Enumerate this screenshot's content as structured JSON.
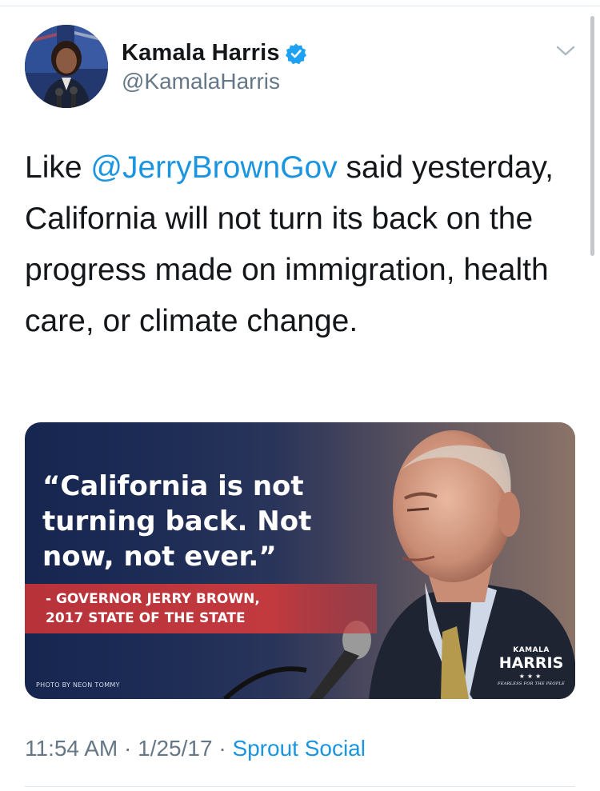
{
  "author": {
    "name": "Kamala Harris",
    "handle": "@KamalaHarris",
    "verified": true,
    "avatar_icon": "profile-photo"
  },
  "tweet": {
    "text_before_mention": "Like ",
    "mention": "@JerryBrownGov",
    "text_after_mention": " said yesterday, California will not turn its back on the progress made on immigration, health care, or climate change."
  },
  "media": {
    "quote": "“California is not turning back. Not now, not ever.”",
    "attribution_line1": "- GOVERNOR JERRY BROWN,",
    "attribution_line2": "2017 STATE OF THE STATE",
    "photo_credit": "PHOTO BY NEON TOMMY",
    "logo_top": "KAMALA",
    "logo_name": "HARRIS",
    "logo_stars": "★★★",
    "logo_tagline": "FEARLESS FOR THE PEOPLE"
  },
  "meta": {
    "time": "11:54 AM",
    "separator": " · ",
    "date": "1/25/17",
    "source": "Sprout Social"
  },
  "colors": {
    "link": "#1b95e0",
    "secondary_text": "#657786",
    "verified_badge": "#1da1f2",
    "banner_red": "#c23a3e",
    "navy": "#17264f"
  }
}
